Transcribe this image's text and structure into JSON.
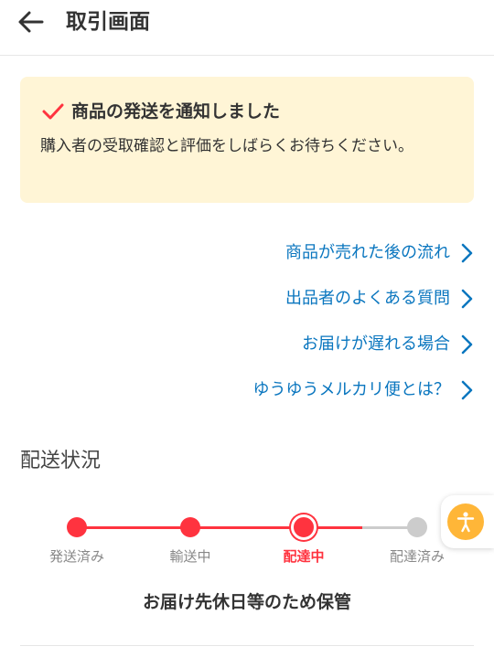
{
  "header": {
    "title": "取引画面",
    "back_icon": "back-arrow-icon"
  },
  "notice": {
    "title": "商品の発送を通知しました",
    "body": "購入者の受取確認と評価をしばらくお待ちください。",
    "icon": "check-icon",
    "background": "#fff5d6",
    "icon_color": "#ff333f"
  },
  "links": [
    {
      "label": "商品が売れた後の流れ"
    },
    {
      "label": "出品者のよくある質問"
    },
    {
      "label": "お届けが遅れる場合"
    },
    {
      "label": "ゆうゆうメルカリ便とは？"
    }
  ],
  "shipping": {
    "section_title": "配送状況",
    "steps": [
      {
        "label": "発送済み",
        "state": "done"
      },
      {
        "label": "輸送中",
        "state": "done"
      },
      {
        "label": "配達中",
        "state": "current"
      },
      {
        "label": "配達済み",
        "state": "pending"
      }
    ],
    "status_text": "お届け先休日等のため保管",
    "active_color": "#ff333f",
    "inactive_color": "#cccccc"
  },
  "accessibility_button": {
    "icon": "accessibility-icon",
    "color": "#ffb638"
  },
  "colors": {
    "link": "#0a76bf"
  }
}
